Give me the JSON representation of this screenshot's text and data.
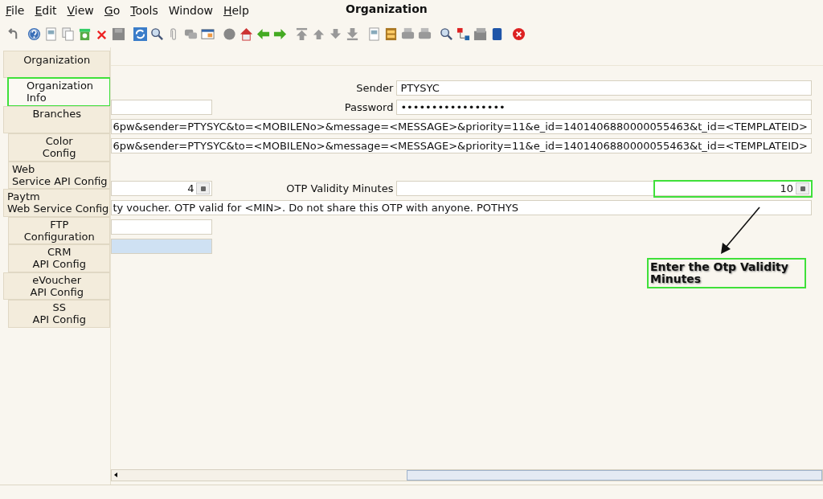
{
  "menu": [
    {
      "label": "File",
      "underlined": true
    },
    {
      "label": "Edit",
      "underlined": true
    },
    {
      "label": "View",
      "underlined": true
    },
    {
      "label": "Go",
      "underlined": true
    },
    {
      "label": "Tools",
      "underlined": true
    },
    {
      "label": "Window",
      "underlined": false
    },
    {
      "label": "Help",
      "underlined": true
    }
  ],
  "window": {
    "title": "Organization"
  },
  "sidebar": {
    "header": "Organization",
    "items": [
      {
        "lines": [
          "Organization",
          "Info"
        ],
        "selected": true,
        "highlighted": true
      },
      {
        "lines": [
          "Branches"
        ],
        "selected": false,
        "highlighted": false
      },
      {
        "lines": [
          "Color",
          "Config"
        ],
        "selected": false,
        "highlighted": false
      },
      {
        "lines": [
          "Web",
          "Service API Config"
        ],
        "selected": false,
        "highlighted": false
      },
      {
        "lines": [
          "Paytm",
          "Web Service Config"
        ],
        "selected": false,
        "highlighted": false
      },
      {
        "lines": [
          "FTP",
          "Configuration"
        ],
        "selected": false,
        "highlighted": false
      },
      {
        "lines": [
          "CRM",
          "API Config"
        ],
        "selected": false,
        "highlighted": false
      },
      {
        "lines": [
          "eVoucher",
          "API Config"
        ],
        "selected": false,
        "highlighted": false
      },
      {
        "lines": [
          "SS",
          "API Config"
        ],
        "selected": false,
        "highlighted": false
      }
    ]
  },
  "form": {
    "rows": [
      {
        "kind": "pair",
        "label": "Sender",
        "right": {
          "kind": "text",
          "value": "PTYSYC",
          "highlighted": false
        }
      },
      {
        "kind": "pair",
        "left": {
          "kind": "text"
        },
        "label": "Password",
        "right": {
          "kind": "text",
          "value": "•••••••••••••••••",
          "highlighted": false
        }
      },
      {
        "kind": "wide",
        "value": "6pw&sender=PTYSYC&to=<MOBILENo>&message=<MESSAGE>&priority=11&e_id=1401406880000055463&t_id=<TEMPLATEID>"
      },
      {
        "kind": "wide",
        "value": "6pw&sender=PTYSYC&to=<MOBILENo>&message=<MESSAGE>&priority=11&e_id=1401406880000055463&t_id=<TEMPLATEID>"
      },
      {
        "kind": "gap"
      },
      {
        "kind": "pair",
        "left": {
          "kind": "number",
          "value": "4"
        },
        "label": "OTP Validity Minutes",
        "right": {
          "kind": "number",
          "value": "10",
          "highlighted": true
        }
      },
      {
        "kind": "wide",
        "value": "ty voucher. OTP valid for <MIN>. Do not share this OTP with anyone. POTHYS"
      },
      {
        "kind": "pair",
        "left": {
          "kind": "text"
        }
      },
      {
        "kind": "pair",
        "left": {
          "kind": "selected"
        }
      }
    ]
  },
  "callout": {
    "text": "Enter the Otp Validity Minutes"
  }
}
